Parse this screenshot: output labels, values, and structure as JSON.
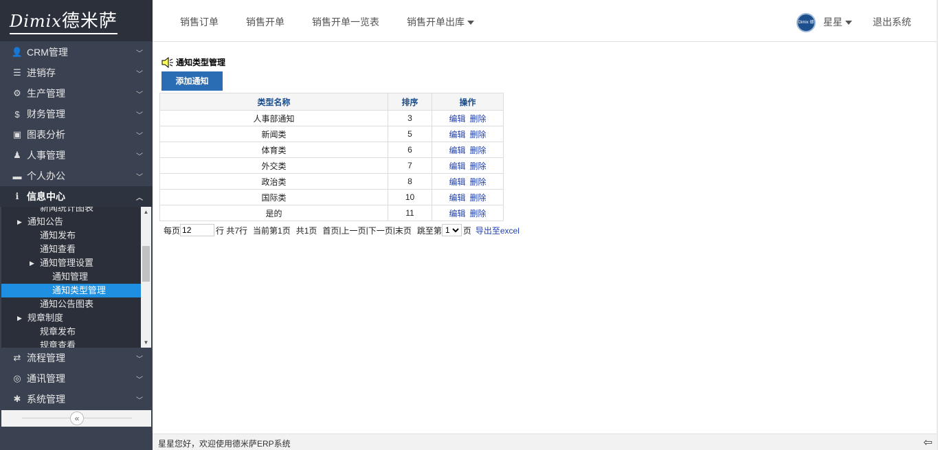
{
  "logo": {
    "latin": "Dimix",
    "chinese": "德米萨"
  },
  "sidebar": {
    "menu_top": [
      {
        "label": "CRM管理",
        "icon": "user-icon"
      },
      {
        "label": "进销存",
        "icon": "list-icon"
      },
      {
        "label": "生产管理",
        "icon": "gears-icon"
      },
      {
        "label": "财务管理",
        "icon": "dollar-icon"
      },
      {
        "label": "图表分析",
        "icon": "image-icon"
      },
      {
        "label": "人事管理",
        "icon": "user-tie-icon"
      },
      {
        "label": "个人办公",
        "icon": "briefcase-icon"
      },
      {
        "label": "信息中心",
        "icon": "info-icon"
      }
    ],
    "submenu": [
      {
        "label": "新闻统计图表",
        "level": 2
      },
      {
        "label": "通知公告",
        "level": 1
      },
      {
        "label": "通知发布",
        "level": 2
      },
      {
        "label": "通知查看",
        "level": 2
      },
      {
        "label": "通知管理设置",
        "level": 2
      },
      {
        "label": "通知管理",
        "level": 3
      },
      {
        "label": "通知类型管理",
        "level": 3
      },
      {
        "label": "通知公告图表",
        "level": 2
      },
      {
        "label": "规章制度",
        "level": 1
      },
      {
        "label": "规章发布",
        "level": 2
      },
      {
        "label": "规章查看",
        "level": 2
      }
    ],
    "menu_bottom": [
      {
        "label": "流程管理",
        "icon": "exchange-icon"
      },
      {
        "label": "通讯管理",
        "icon": "comments-icon"
      },
      {
        "label": "系统管理",
        "icon": "cog-icon"
      }
    ],
    "collapse_glyph": "«"
  },
  "header": {
    "nav": [
      "销售订单",
      "销售开单",
      "销售开单一览表",
      "销售开单出库"
    ],
    "avatar_text": "Dimix 德米萨",
    "user": "星星",
    "logout": "退出系统"
  },
  "page": {
    "title": "通知类型管理",
    "add_button": "添加通知"
  },
  "table": {
    "headers": [
      "类型名称",
      "排序",
      "操作"
    ],
    "rows": [
      {
        "name": "人事部通知",
        "order": "3"
      },
      {
        "name": "新闻类",
        "order": "5"
      },
      {
        "name": "体育类",
        "order": "6"
      },
      {
        "name": "外交类",
        "order": "7"
      },
      {
        "name": "政治类",
        "order": "8"
      },
      {
        "name": "国际类",
        "order": "10"
      },
      {
        "name": "是的",
        "order": "11"
      }
    ],
    "edit_label": "编辑",
    "delete_label": "删除"
  },
  "pager": {
    "per_page_prefix": "每页",
    "per_page_value": "12",
    "rows_text": "行 共7行",
    "current_text": "当前第1页",
    "total_text": "共1页",
    "first": "首页",
    "prev": "上一页",
    "next": "下一页",
    "last": "末页",
    "sep": "|",
    "jump_prefix": "跳至第",
    "jump_value": "1",
    "jump_suffix": "页",
    "export": "导出至excel"
  },
  "footer": {
    "text": "星星您好，欢迎使用德米萨ERP系统",
    "icon_glyph": "⇦"
  }
}
